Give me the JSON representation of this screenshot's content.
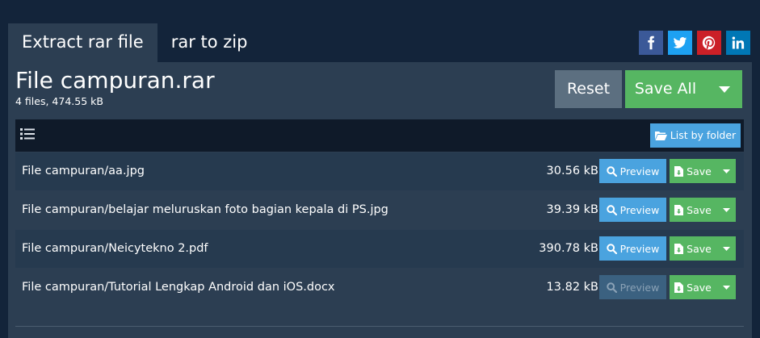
{
  "tabs": [
    {
      "label": "Extract rar file",
      "active": true
    },
    {
      "label": "rar to zip",
      "active": false
    }
  ],
  "social": [
    {
      "name": "facebook-icon",
      "color": "#3b5998"
    },
    {
      "name": "twitter-icon",
      "color": "#1da1f2"
    },
    {
      "name": "pinterest-icon",
      "color": "#cb2027"
    },
    {
      "name": "linkedin-icon",
      "color": "#0077b5"
    }
  ],
  "archive": {
    "title": "File campuran.rar",
    "summary": "4 files, 474.55 kB"
  },
  "actions": {
    "reset_label": "Reset",
    "save_all_label": "Save All"
  },
  "toolbar": {
    "list_by_folder_label": "List by folder"
  },
  "files": [
    {
      "name": "File campuran/aa.jpg",
      "size": "30.56 kB",
      "preview_label": "Preview",
      "preview_enabled": true,
      "save_label": "Save"
    },
    {
      "name": "File campuran/belajar meluruskan foto bagian kepala di PS.jpg",
      "size": "39.39 kB",
      "preview_label": "Preview",
      "preview_enabled": true,
      "save_label": "Save"
    },
    {
      "name": "File campuran/Neicytekno 2.pdf",
      "size": "390.78 kB",
      "preview_label": "Preview",
      "preview_enabled": true,
      "save_label": "Save"
    },
    {
      "name": "File campuran/Tutorial Lengkap Android dan iOS.docx",
      "size": "13.82 kB",
      "preview_label": "Preview",
      "preview_enabled": false,
      "save_label": "Save"
    }
  ],
  "colors": {
    "background": "#13243a",
    "panel": "#2c3e52",
    "primary_blue": "#4aa3df",
    "success_green": "#56b662",
    "reset_gray": "#5c6f80"
  }
}
